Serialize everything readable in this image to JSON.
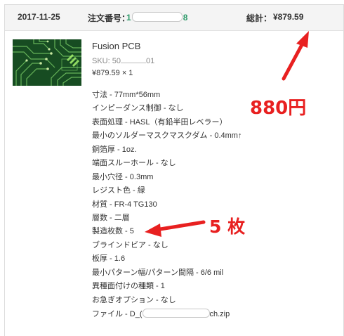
{
  "order": {
    "date": "2017-11-25",
    "number_label": "注文番号：",
    "number_prefix": "1",
    "number_suffix": "8",
    "total_label": "総計：",
    "total_value": "¥879.59"
  },
  "product": {
    "name": "Fusion PCB",
    "sku_prefix": "SKU: 50",
    "sku_suffix": "01",
    "price_line": "¥879.59 × 1"
  },
  "specs": [
    "寸法 - 77mm*56mm",
    "インピーダンス制御 - なし",
    "表面処理 - HASL（有鉛半田レベラー）",
    "最小のソルダーマスクマスクダム - 0.4mm↑",
    "銅箔厚 - 1oz.",
    "端面スルーホール - なし",
    "最小穴径 - 0.3mm",
    "レジスト色 - 緑",
    "材質 - FR-4 TG130",
    "層数 - 二層",
    "製造枚数 - 5",
    "ブラインドビア - なし",
    "板厚 - 1.6",
    "最小パターン幅/パターン間隔 - 6/6 mil",
    "異種面付けの種類 - 1",
    "お急ぎオプション - なし"
  ],
  "file": {
    "prefix": "ファイル - D_(",
    "suffix": "ch.zip"
  },
  "annotations": {
    "price_note": "880円",
    "count_note": "5 枚",
    "color": "#e82020"
  },
  "icons": {
    "thumbnail": "pcb-thumbnail-image"
  }
}
